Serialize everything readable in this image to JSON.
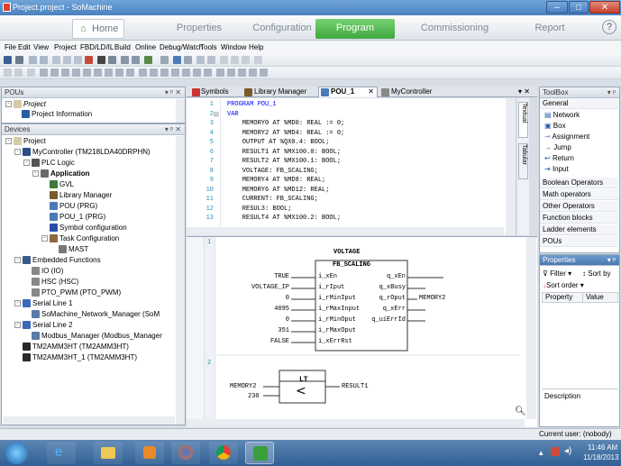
{
  "window": {
    "title": "Project.project - SoMachine"
  },
  "nav": {
    "home": "Home",
    "tabs": [
      "Properties",
      "Configuration",
      "Program",
      "Commissioning",
      "Report"
    ],
    "active": "Program",
    "help": "?"
  },
  "menu": [
    "File",
    "Edit",
    "View",
    "Project",
    "FBD/LD/IL",
    "Build",
    "Online",
    "Debug/Watch",
    "Tools",
    "Window",
    "Help"
  ],
  "pous_panel": {
    "title": "POUs",
    "project": "Project",
    "project_info": "Project Information"
  },
  "devices_panel": {
    "title": "Devices",
    "items": [
      {
        "label": "Project",
        "indent": 0,
        "icon": "project-icon",
        "exp": "-"
      },
      {
        "label": "MyController (TM218LDA40DRPHN)",
        "indent": 1,
        "icon": "controller-icon",
        "exp": "-"
      },
      {
        "label": "PLC Logic",
        "indent": 2,
        "icon": "plc-logic-icon",
        "exp": "-"
      },
      {
        "label": "Application",
        "indent": 3,
        "icon": "application-icon",
        "exp": "-",
        "bold": true
      },
      {
        "label": "GVL",
        "indent": 4,
        "icon": "gvl-icon"
      },
      {
        "label": "Library Manager",
        "indent": 4,
        "icon": "library-icon"
      },
      {
        "label": "POU (PRG)",
        "indent": 4,
        "icon": "pou-icon"
      },
      {
        "label": "POU_1 (PRG)",
        "indent": 4,
        "icon": "pou-icon"
      },
      {
        "label": "Symbol configuration",
        "indent": 4,
        "icon": "symbol-icon"
      },
      {
        "label": "Task Configuration",
        "indent": 4,
        "icon": "task-icon",
        "exp": "-"
      },
      {
        "label": "MAST",
        "indent": 5,
        "icon": "mast-icon"
      },
      {
        "label": "Embedded Functions",
        "indent": 1,
        "icon": "embedded-icon",
        "exp": "-"
      },
      {
        "label": "IO (IO)",
        "indent": 2,
        "icon": "io-icon"
      },
      {
        "label": "HSC (HSC)",
        "indent": 2,
        "icon": "hsc-icon"
      },
      {
        "label": "PTO_PWM (PTO_PWM)",
        "indent": 2,
        "icon": "pto-icon"
      },
      {
        "label": "Serial Line 1",
        "indent": 1,
        "icon": "serial-icon",
        "exp": "-"
      },
      {
        "label": "SoMachine_Network_Manager (SoM",
        "indent": 2,
        "icon": "network-manager-icon"
      },
      {
        "label": "Serial Line 2",
        "indent": 1,
        "icon": "serial-icon",
        "exp": "-"
      },
      {
        "label": "Modbus_Manager (Modbus_Manager",
        "indent": 2,
        "icon": "modbus-icon"
      },
      {
        "label": "TM2AMM3HT (TM2AMM3HT)",
        "indent": 1,
        "icon": "module-icon"
      },
      {
        "label": "TM2AMM3HT_1 (TM2AMM3HT)",
        "indent": 1,
        "icon": "module-icon"
      }
    ]
  },
  "editor_tabs": [
    "Symbols",
    "Library Manager",
    "POU_1",
    "MyController"
  ],
  "editor_active": "POU_1",
  "side_tabs": [
    "Textual",
    "Tabular"
  ],
  "code_lines": [
    {
      "n": "1",
      "text": "PROGRAM POU_1",
      "kw": true
    },
    {
      "n": "2",
      "text": "VAR",
      "kw": true
    },
    {
      "n": "3",
      "text": "    MEMORY0 AT %MD0: REAL := 0;"
    },
    {
      "n": "4",
      "text": "    MEMORY2 AT %MD4: REAL := 0;"
    },
    {
      "n": "5",
      "text": "    OUTPUT AT %QX0.4: BOOL;"
    },
    {
      "n": "6",
      "text": "    RESULT1 AT %MX100.0: BOOL;"
    },
    {
      "n": "7",
      "text": "    RESULT2 AT %MX100.1: BOOL;"
    },
    {
      "n": "8",
      "text": "    VOLTAGE: FB_SCALING;"
    },
    {
      "n": "9",
      "text": "    MEMORY4 AT %MD8: REAL;"
    },
    {
      "n": "10",
      "text": "    MEMORY6 AT %MD12: REAL;"
    },
    {
      "n": "11",
      "text": "    CURRENT: FB_SCALING;"
    },
    {
      "n": "12",
      "text": "    RESUL3: BOOL;"
    },
    {
      "n": "13",
      "text": "    RESULT4 AT %MX100.2: BOOL;"
    }
  ],
  "fbd": {
    "network1_num": "1",
    "network2_num": "2",
    "instance": "VOLTAGE",
    "block_type": "FB_SCALING",
    "inputs": [
      {
        "value": "TRUE",
        "pin": "i_xEn"
      },
      {
        "value": "VOLTAGE_IP",
        "pin": "i_rIput"
      },
      {
        "value": "0",
        "pin": "i_rMinIput"
      },
      {
        "value": "4095",
        "pin": "i_rMaxInput"
      },
      {
        "value": "0",
        "pin": "i_rMinOput"
      },
      {
        "value": "351",
        "pin": "i_rMaxOput"
      },
      {
        "value": "FALSE",
        "pin": "i_xErrRst"
      }
    ],
    "outputs": [
      {
        "pin": "q_xEn",
        "value": ""
      },
      {
        "pin": "q_xBusy",
        "value": ""
      },
      {
        "pin": "q_rOput",
        "value": "MEMORY2"
      },
      {
        "pin": "q_xErr",
        "value": ""
      },
      {
        "pin": "q_uiErrId",
        "value": ""
      }
    ],
    "lt_title": "LT",
    "lt_symbol": "<",
    "lt_in1": "MEMORY2",
    "lt_in2": "230",
    "lt_out": "RESULT1"
  },
  "toolbox": {
    "title": "ToolBox",
    "general": "General",
    "general_items": [
      {
        "label": "Network",
        "icon": "network-icon"
      },
      {
        "label": "Box",
        "icon": "box-icon"
      },
      {
        "label": "Assignment",
        "icon": "assignment-icon"
      },
      {
        "label": "Jump",
        "icon": "jump-icon"
      },
      {
        "label": "Return",
        "icon": "return-icon"
      },
      {
        "label": "Input",
        "icon": "input-icon"
      }
    ],
    "categories": [
      "Boolean Operators",
      "Math operators",
      "Other Operators",
      "Function blocks",
      "Ladder elements",
      "POUs"
    ]
  },
  "properties": {
    "title": "Properties",
    "filter": "Filter",
    "sort_by": "Sort by",
    "sort_order": "Sort order",
    "col_property": "Property",
    "col_value": "Value",
    "description": "Description"
  },
  "status": {
    "user": "Current user: (nobody)"
  },
  "taskbar": {
    "time": "11:46 AM",
    "date": "11/18/2013"
  },
  "colors": {
    "accent_green": "#3fa83d",
    "title_blue": "#4a80bf",
    "keyword": "#0000ff"
  }
}
